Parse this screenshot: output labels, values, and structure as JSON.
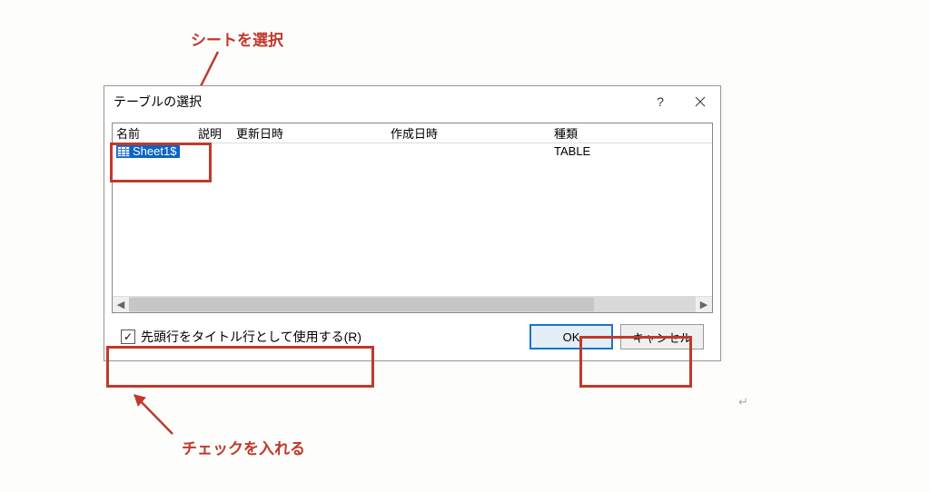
{
  "annotations": {
    "top": "シートを選択",
    "bottom": "チェックを入れる"
  },
  "dialog": {
    "title": "テーブルの選択",
    "help_label": "?",
    "columns": {
      "name": "名前",
      "description": "説明",
      "updated": "更新日時",
      "created": "作成日時",
      "kind": "種類"
    },
    "rows": [
      {
        "name": "Sheet1$",
        "description": "",
        "updated": "",
        "created": "",
        "kind": "TABLE"
      }
    ],
    "checkbox": {
      "checked": true,
      "label": "先頭行をタイトル行として使用する(R)"
    },
    "buttons": {
      "ok": "OK",
      "cancel": "キャンセル"
    }
  }
}
